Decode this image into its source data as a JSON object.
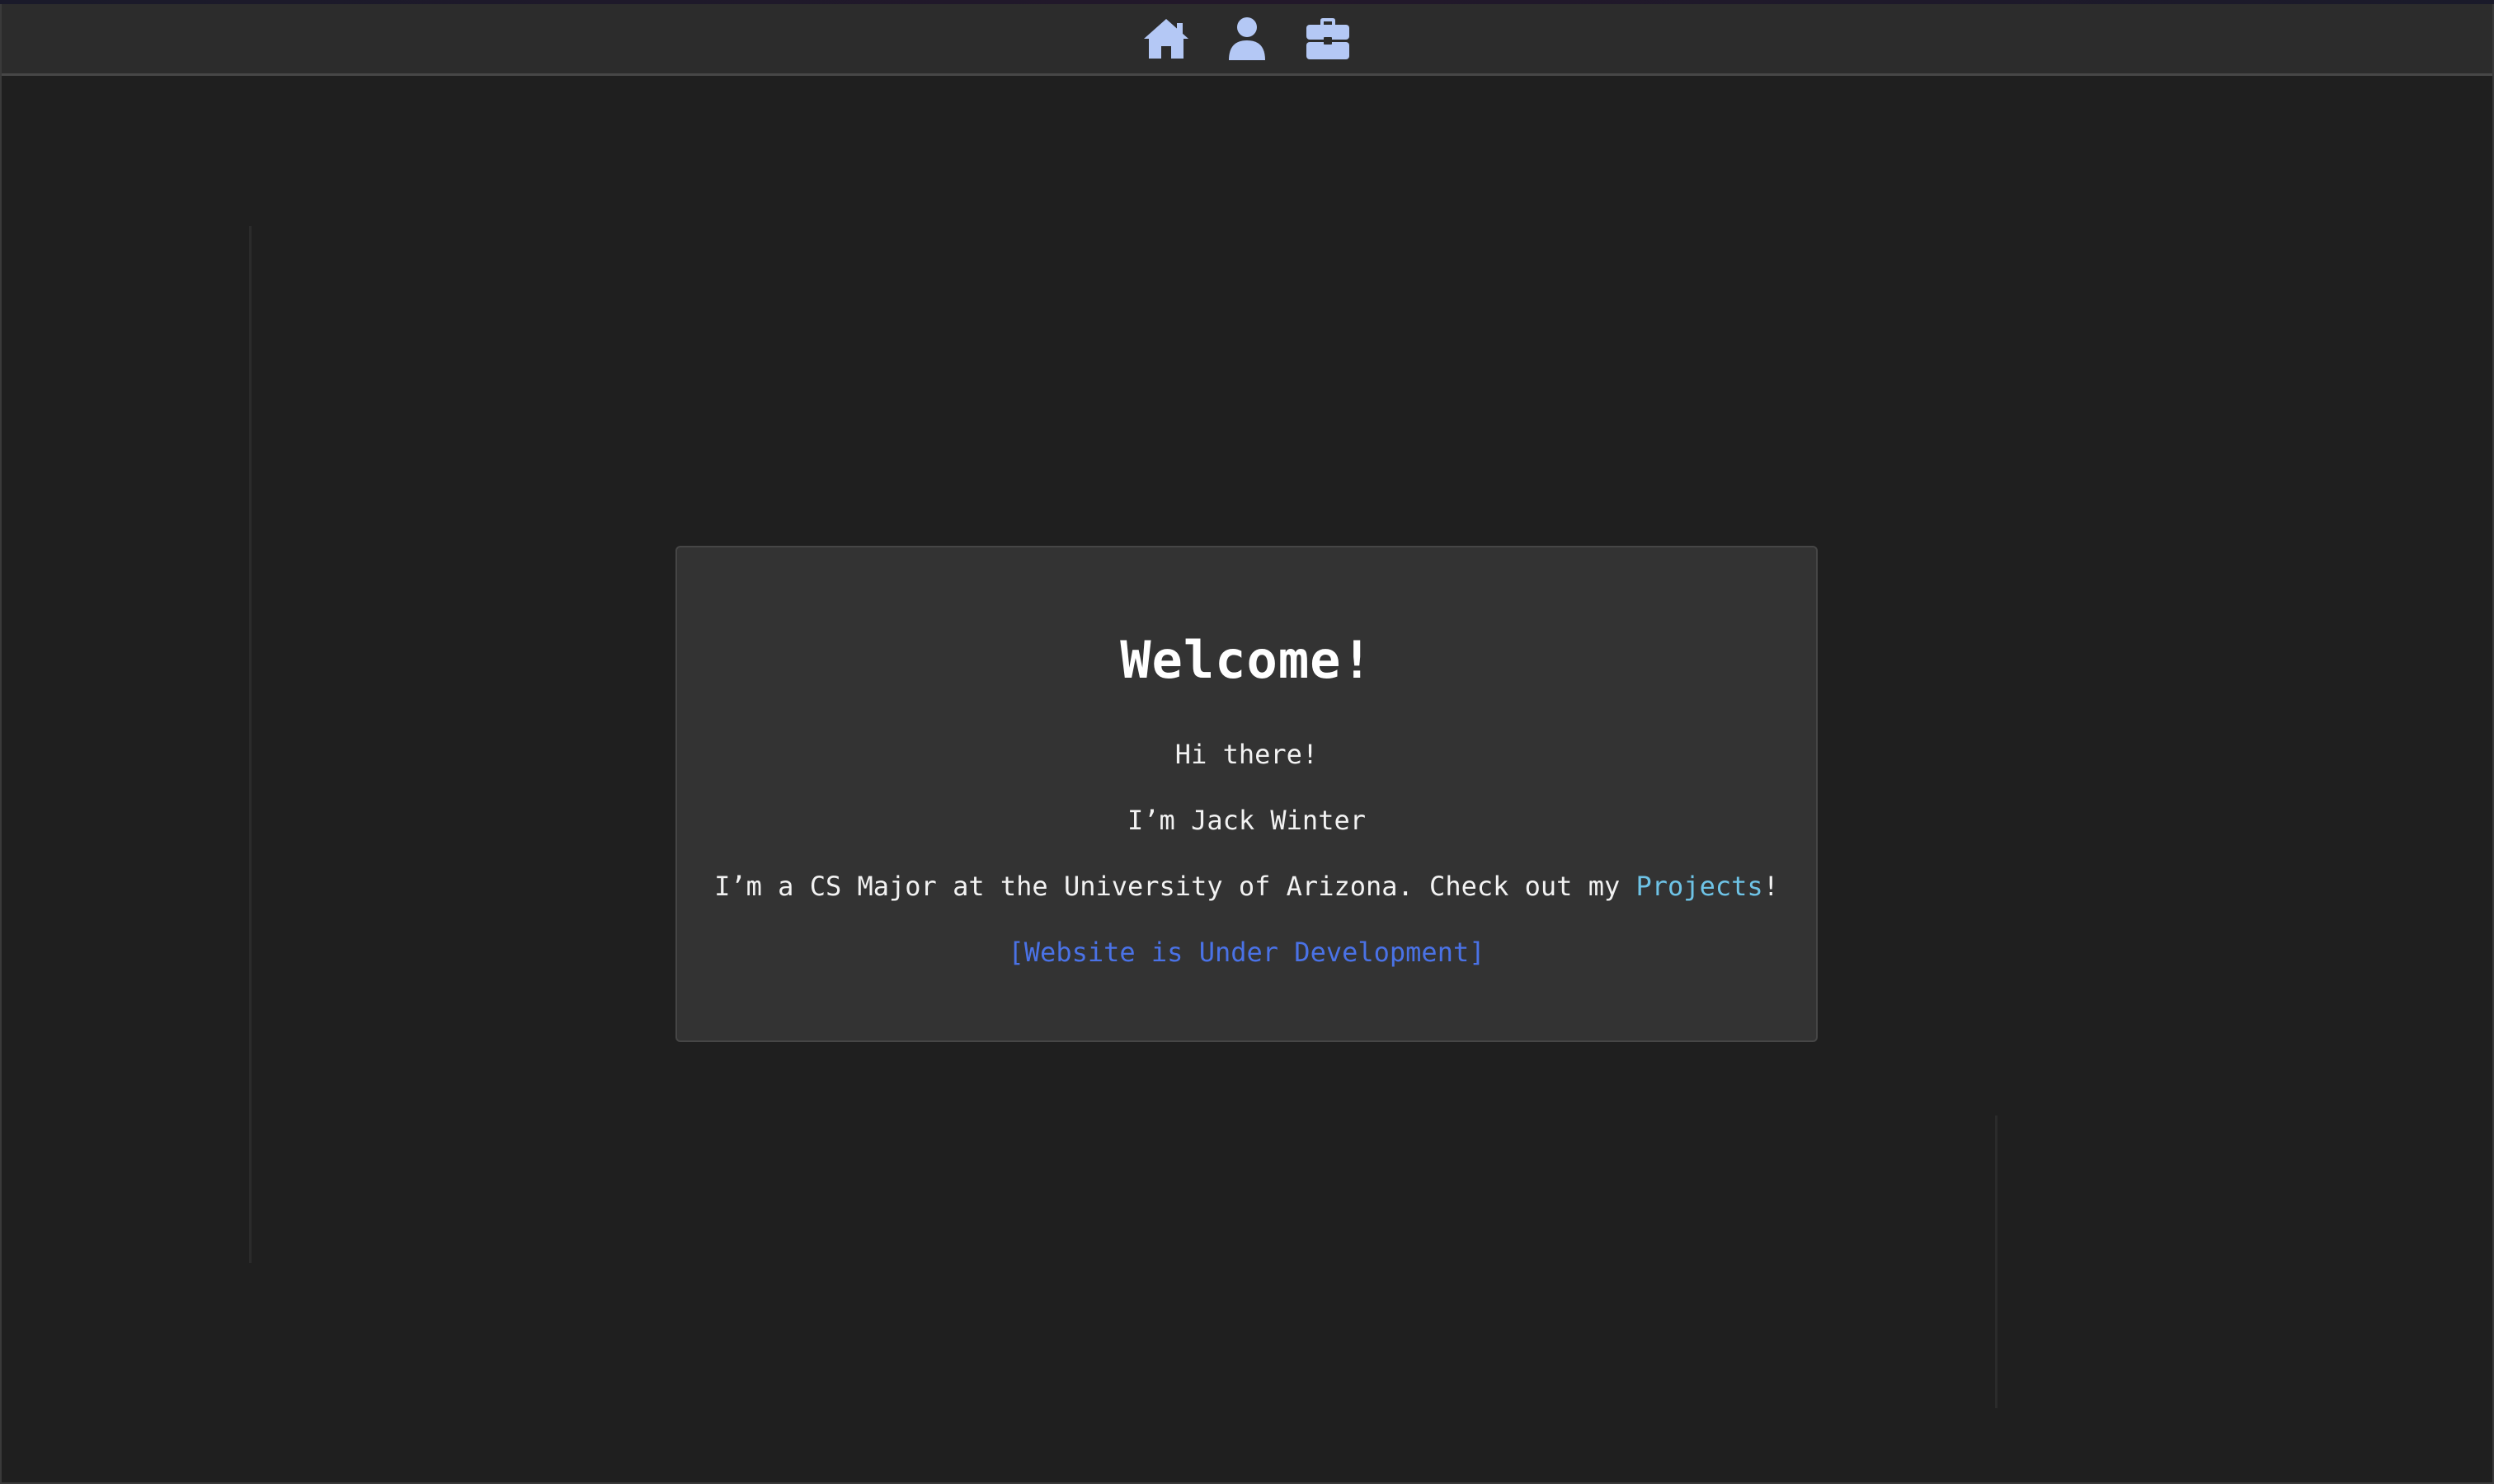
{
  "nav": {
    "items": [
      {
        "icon": "home-icon",
        "label": "Home"
      },
      {
        "icon": "user-icon",
        "label": "About"
      },
      {
        "icon": "briefcase-icon",
        "label": "Projects"
      }
    ],
    "icon_color": "#b4c8f5"
  },
  "card": {
    "title": "Welcome!",
    "greeting": "Hi there!",
    "intro": "I’m Jack Winter",
    "description_prefix": "I’m a CS Major at the University of Arizona. Check out my ",
    "projects_link": "Projects",
    "description_suffix": "!",
    "status": "[Website is Under Development]"
  },
  "colors": {
    "background": "#1f1f1f",
    "navbar": "#2c2c2c",
    "card": "#333333",
    "link": "#6ec3e6",
    "status": "#4a72e6"
  }
}
